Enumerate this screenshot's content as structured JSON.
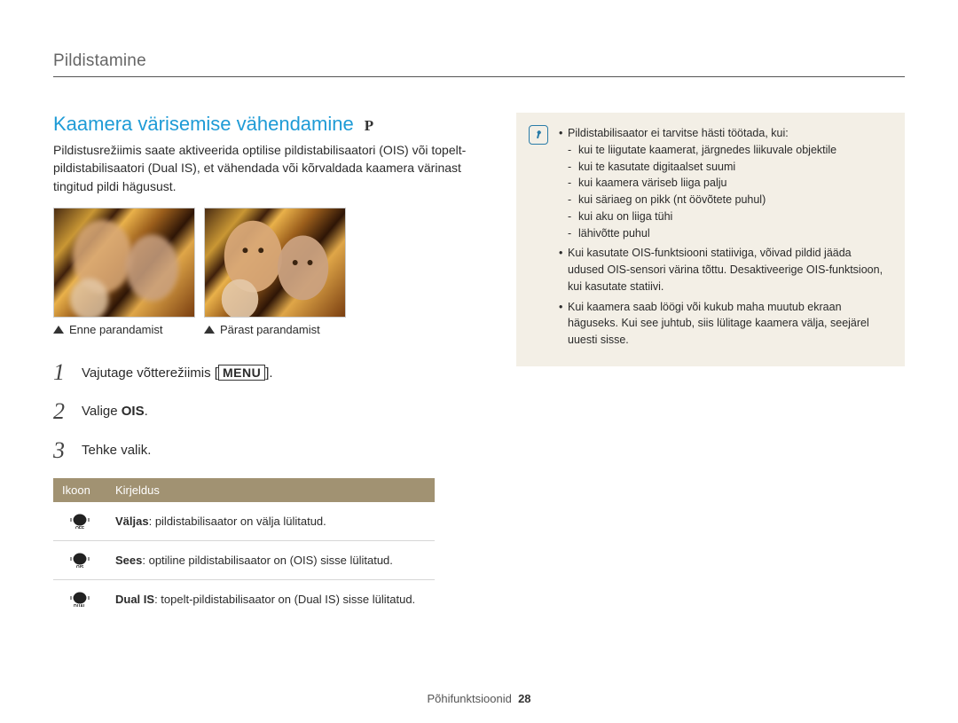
{
  "section_header": "Pildistamine",
  "title": "Kaamera värisemise vähendamine",
  "mode_badge": "P",
  "intro": "Pildistusrežiimis saate aktiveerida optilise pildistabilisaatori (OIS) või topelt-pildistabilisaatori (Dual IS), et vähendada või kõrvaldada kaamera värinast tingitud pildi hägusust.",
  "caption_before": "Enne parandamist",
  "caption_after": "Pärast parandamist",
  "steps": {
    "s1_pre": "Vajutage võtterežiimis [",
    "s1_menu": "MENU",
    "s1_post": "].",
    "s2_pre": "Valige ",
    "s2_bold": "OIS",
    "s2_post": ".",
    "s3": "Tehke valik."
  },
  "table": {
    "h_icon": "Ikoon",
    "h_desc": "Kirjeldus",
    "rows": [
      {
        "sub": "OFF",
        "label": "Väljas",
        "desc": ": pildistabilisaator on välja lülitatud."
      },
      {
        "sub": "OIS",
        "label": "Sees",
        "desc": ": optiline pildistabilisaator on (OIS) sisse lülitatud."
      },
      {
        "sub": "DUAL",
        "label": "Dual IS",
        "desc": ": topelt-pildistabilisaator on (Dual IS) sisse lülitatud."
      }
    ]
  },
  "note": {
    "l1": "Pildistabilisaator ei tarvitse hästi töötada, kui:",
    "l1a": "kui te liigutate kaamerat, järgnedes liikuvale objektile",
    "l1b": "kui te kasutate digitaalset suumi",
    "l1c": "kui kaamera väriseb liiga palju",
    "l1d": "kui säriaeg on pikk (nt öövõtete puhul)",
    "l1e": "kui aku on liiga tühi",
    "l1f": "lähivõtte puhul",
    "l2": "Kui kasutate OIS-funktsiooni statiiviga, võivad pildid jääda udused OIS-sensori värina tõttu. Desaktiveerige OIS-funktsioon, kui kasutate statiivi.",
    "l3": "Kui kaamera saab löögi või kukub maha muutub ekraan häguseks. Kui see juhtub, siis lülitage kaamera välja, seejärel uuesti sisse."
  },
  "footer_label": "Põhifunktsioonid",
  "footer_page": "28"
}
